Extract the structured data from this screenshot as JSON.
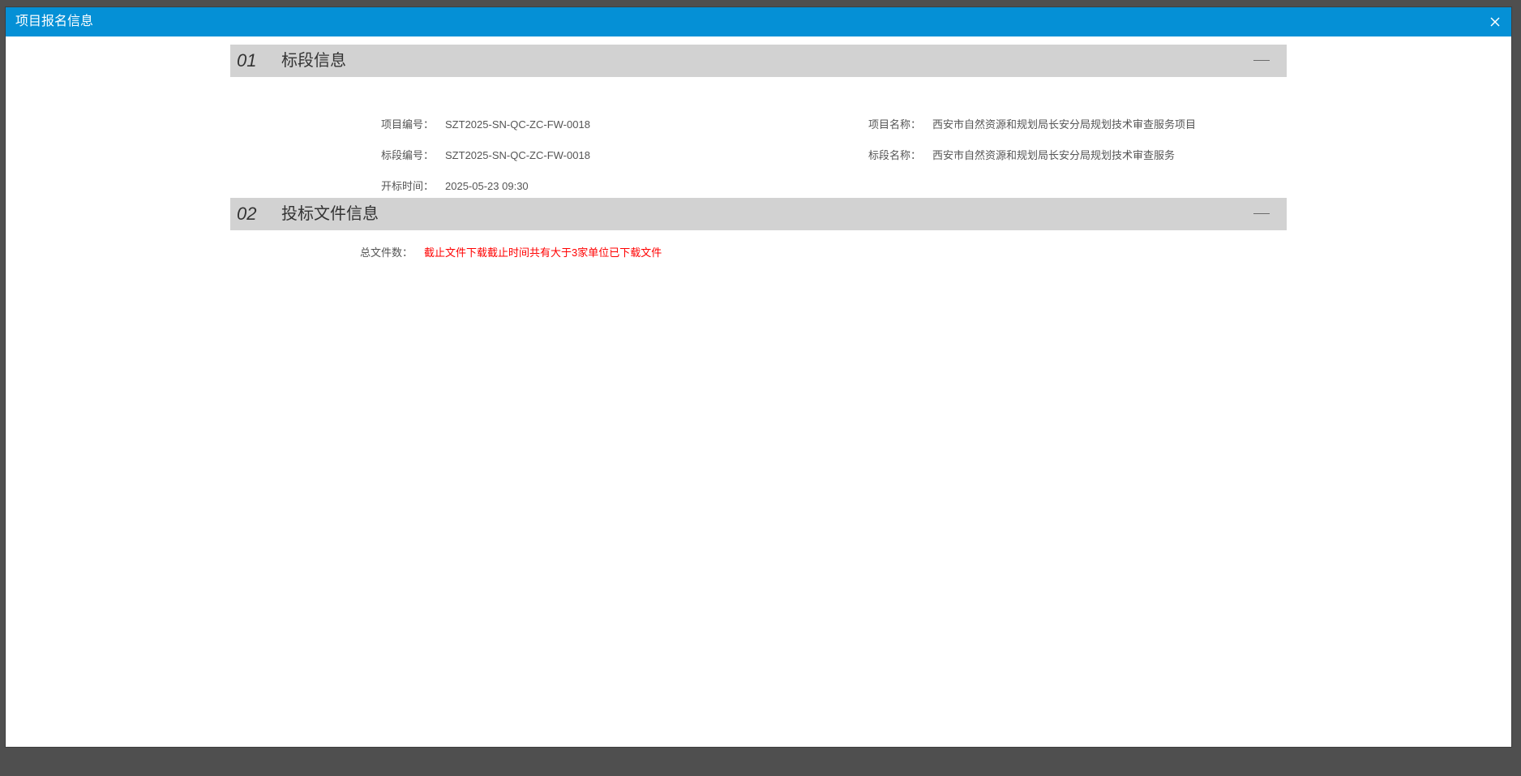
{
  "dialog": {
    "title": "项目报名信息"
  },
  "sections": [
    {
      "number": "01",
      "title": "标段信息",
      "fields": {
        "project_code": {
          "label": "项目编号：",
          "value": "SZT2025-SN-QC-ZC-FW-0018"
        },
        "project_name": {
          "label": "项目名称：",
          "value": "西安市自然资源和规划局长安分局规划技术审查服务项目"
        },
        "section_code": {
          "label": "标段编号：",
          "value": "SZT2025-SN-QC-ZC-FW-0018"
        },
        "section_name": {
          "label": "标段名称：",
          "value": "西安市自然资源和规划局长安分局规划技术审查服务"
        },
        "open_time": {
          "label": "开标时间：",
          "value": "2025-05-23 09:30"
        }
      }
    },
    {
      "number": "02",
      "title": "投标文件信息",
      "fields": {
        "total_files": {
          "label": "总文件数：",
          "value": "截止文件下载截止时间共有大于3家单位已下载文件"
        }
      }
    }
  ],
  "colors": {
    "titlebar": "#0590d6",
    "section_header": "#d2d2d2",
    "warning_text": "#ff0000"
  },
  "icons": {
    "close": "close-icon",
    "collapse": "minus-icon"
  }
}
